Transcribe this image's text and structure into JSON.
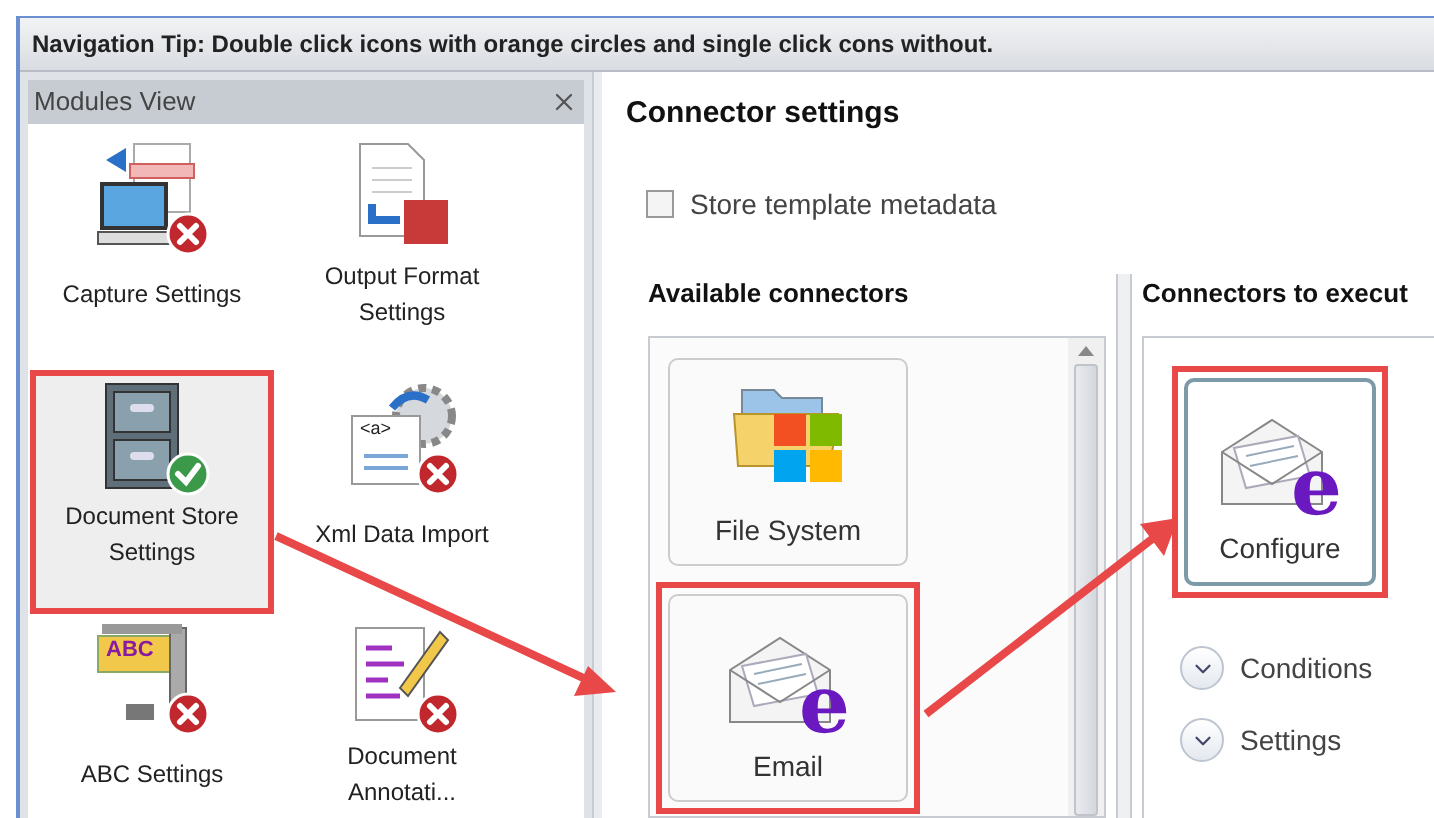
{
  "tip": "Navigation Tip: Double click icons with orange circles and single click cons without.",
  "modules_view": {
    "title": "Modules View",
    "items": [
      {
        "label": "Capture Settings",
        "kind": "capture",
        "error": true,
        "done": false,
        "highlighted": false
      },
      {
        "label": "Output Format Settings",
        "kind": "pdf",
        "error": false,
        "done": false,
        "highlighted": false
      },
      {
        "label": "Document Store Settings",
        "kind": "cabinet",
        "error": false,
        "done": true,
        "highlighted": true
      },
      {
        "label": "Xml Data Import",
        "kind": "xml",
        "error": true,
        "done": false,
        "highlighted": false,
        "icon_text": "<a>"
      },
      {
        "label": "ABC Settings",
        "kind": "abc",
        "error": true,
        "done": false,
        "highlighted": false,
        "icon_text": "ABC"
      },
      {
        "label": "Document Annotati...",
        "kind": "annotate",
        "error": true,
        "done": false,
        "highlighted": false
      }
    ]
  },
  "connector_settings": {
    "title": "Connector settings",
    "checkbox": {
      "label": "Store template metadata",
      "checked": false
    },
    "available": {
      "title": "Available connectors",
      "items": [
        {
          "label": "File System",
          "kind": "folder",
          "highlighted": false
        },
        {
          "label": "Email",
          "kind": "email",
          "highlighted": true,
          "icon_text": "e"
        }
      ]
    },
    "execute": {
      "title": "Connectors to execut",
      "items": [
        {
          "label": "Configure",
          "kind": "email",
          "highlighted": true,
          "icon_text": "e"
        }
      ],
      "sections": [
        {
          "label": "Conditions",
          "expanded": false
        },
        {
          "label": "Settings",
          "expanded": false
        }
      ]
    }
  }
}
